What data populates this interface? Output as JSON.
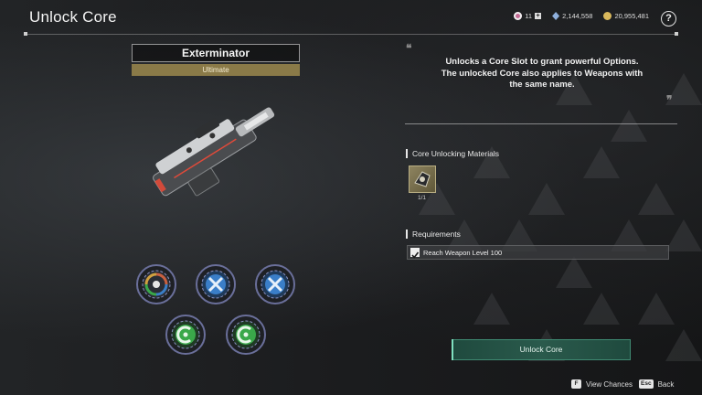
{
  "header": {
    "title": "Unlock Core",
    "currencies": [
      {
        "icon": "pink-gem-icon",
        "value": "11",
        "color": "#d07aa0"
      },
      {
        "icon": "blue-crystal-icon",
        "value": "2,144,558",
        "color": "#7a9fd0"
      },
      {
        "icon": "gold-coin-icon",
        "value": "20,955,481",
        "color": "#d0b060"
      }
    ],
    "help_label": "?"
  },
  "weapon": {
    "name": "Exterminator",
    "rarity": "Ultimate",
    "rarity_color": "#8a7a48"
  },
  "core_slots": [
    {
      "icon": "multi-core-icon",
      "color": "#c86040"
    },
    {
      "icon": "blue-core-icon",
      "color": "#3a7ec8"
    },
    {
      "icon": "blue-core-icon",
      "color": "#3a7ec8"
    },
    {
      "icon": "green-core-icon",
      "color": "#3aa84a"
    },
    {
      "icon": "green-core-icon",
      "color": "#3aa84a"
    }
  ],
  "description": {
    "line1": "Unlocks a Core Slot to grant powerful Options.",
    "line2": "The unlocked Core also applies to Weapons with",
    "line3": "the same name."
  },
  "materials": {
    "title": "Core Unlocking Materials",
    "items": [
      {
        "icon": "core-material-icon",
        "count": "1/1"
      }
    ]
  },
  "requirements": {
    "title": "Requirements",
    "items": [
      {
        "text": "Reach Weapon Level 100",
        "met": true
      }
    ]
  },
  "actions": {
    "unlock_label": "Unlock Core",
    "accent": "#3f8a72"
  },
  "footer": {
    "hints": [
      {
        "key": "F",
        "label": "View Chances"
      },
      {
        "key": "Esc",
        "label": "Back"
      }
    ]
  }
}
